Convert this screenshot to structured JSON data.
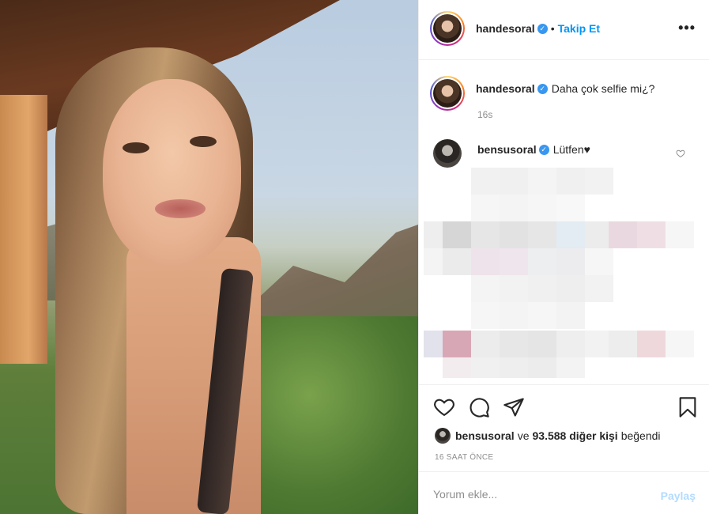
{
  "post": {
    "photo_alt": "selfie photo"
  },
  "header": {
    "username": "handesoral",
    "separator": "•",
    "follow_label": "Takip Et",
    "more_label": "•••"
  },
  "caption": {
    "username": "handesoral",
    "text": "Daha çok selfie mi¿?",
    "time": "16s"
  },
  "comments": [
    {
      "username": "bensusoral",
      "text": "Lütfen♥"
    }
  ],
  "actions": {
    "like_icon": "heart-icon",
    "comment_icon": "comment-icon",
    "share_icon": "share-icon",
    "save_icon": "bookmark-icon"
  },
  "likes": {
    "first_user": "bensusoral",
    "connector": "ve",
    "count_text": "93.588 diğer kişi",
    "suffix": "beğendi"
  },
  "date": "16 SAAT ÖNCE",
  "add_comment": {
    "placeholder": "Yorum ekle...",
    "post_label": "Paylaş"
  },
  "colors": {
    "accent": "#0095f6",
    "verified": "#3897f0",
    "border": "#efefef",
    "muted": "#8e8e8e",
    "post_disabled": "#b3dbff"
  }
}
